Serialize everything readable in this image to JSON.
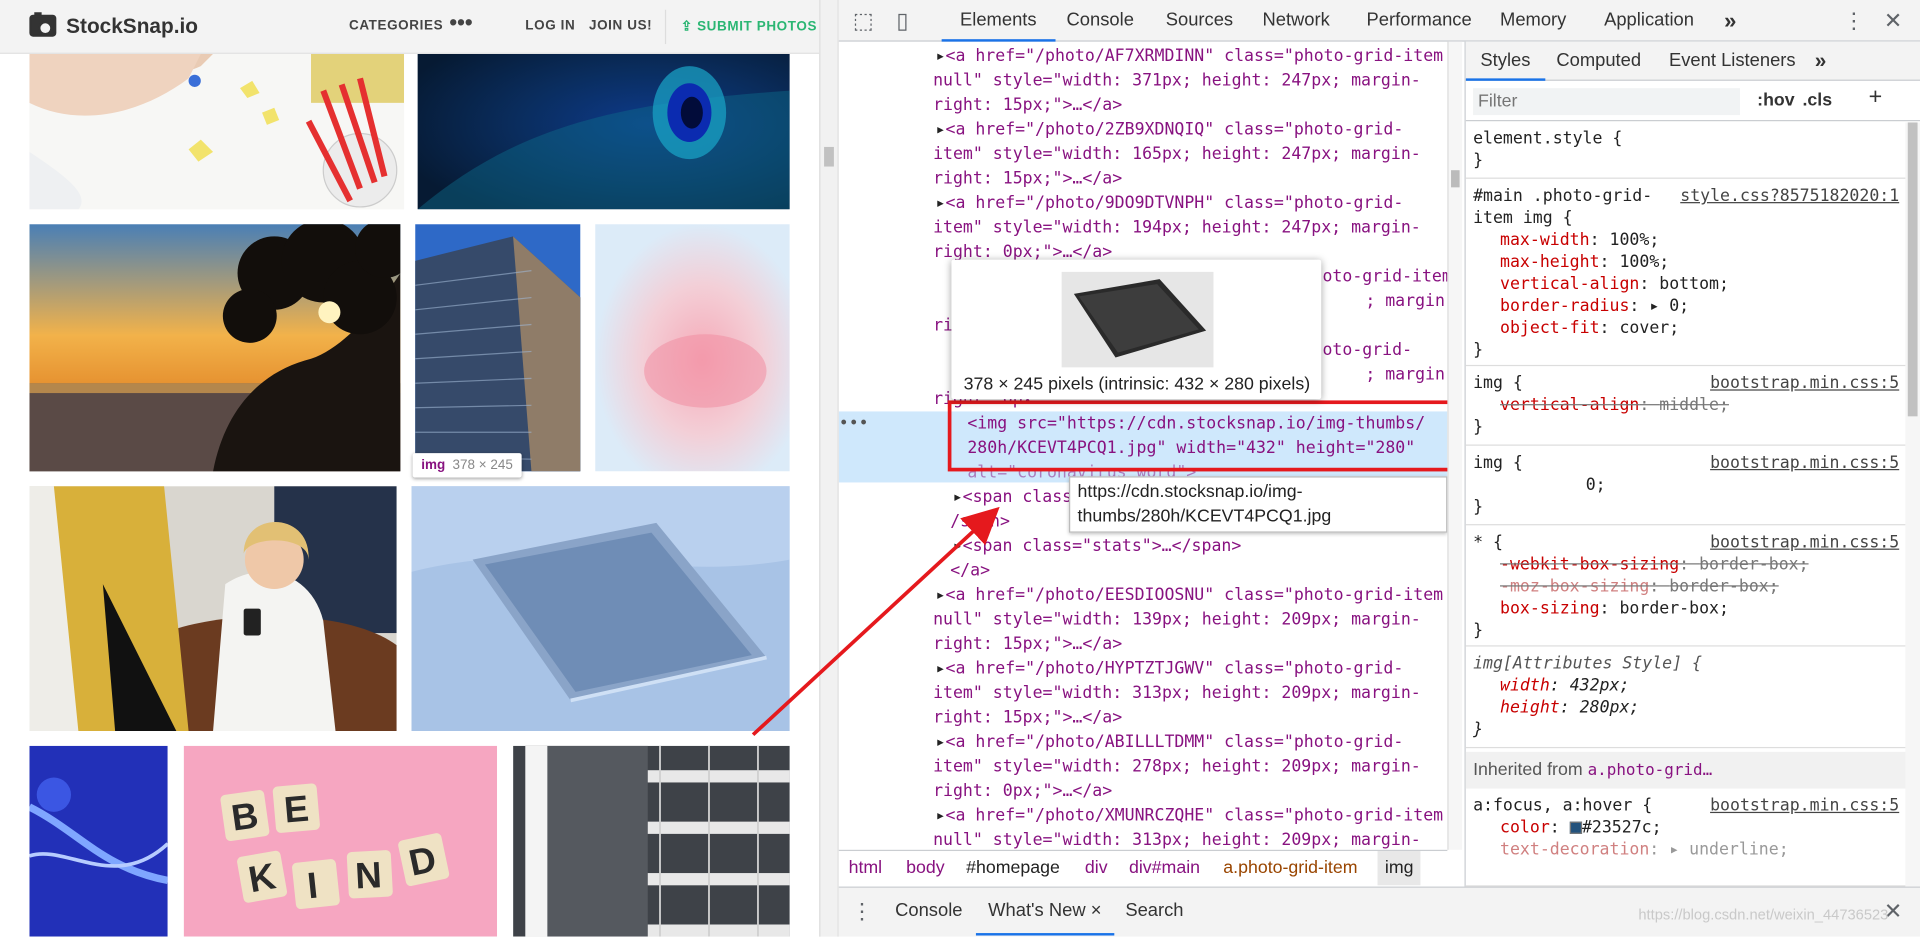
{
  "site": {
    "logo_text": "StockSnap.io",
    "nav": {
      "categories": "CATEGORIES",
      "more": "•••",
      "login": "LOG IN",
      "join": "JOIN US!",
      "submit": "SUBMIT PHOTOS"
    },
    "hover_tag": {
      "tag": "img",
      "size": "378 × 245"
    }
  },
  "devtools": {
    "tabs": [
      "Elements",
      "Console",
      "Sources",
      "Network",
      "Performance",
      "Memory",
      "Application"
    ],
    "more_tabs": "»",
    "dom_lines": [
      "<a href=\"/photo/AF7XRMDINN\" class=\"photo-grid-item",
      "null\" style=\"width: 371px; height: 247px; margin-",
      "right: 15px;\">…</a>",
      "<a href=\"/photo/2ZB9XDNQIQ\" class=\"photo-grid-",
      "item\" style=\"width: 165px; height: 247px; margin-",
      "right: 15px;\">…</a>",
      "<a href=\"/photo/9DO9DTVNPH\" class=\"photo-grid-",
      "item\" style=\"width: 194px; height: 247px; margin-",
      "right: 0px;\">…</a>"
    ],
    "selected_lines": [
      "<img src=\"https://cdn.stocksnap.io/img-thumbs/",
      "280h/KCEVT4PCQ1.jpg\" width=\"432\" height=\"280\""
    ],
    "after_lines": [
      "<span class",
      "/span>",
      "<span class=\"stats\">…</span>",
      "</a>",
      "<a href=\"/photo/EESDIOOSNU\" class=\"photo-grid-item",
      "null\" style=\"width: 139px; height: 209px; margin-",
      "right: 15px;\">…</a>",
      "<a href=\"/photo/HYPTZTJGWV\" class=\"photo-grid-",
      "item\" style=\"width: 313px; height: 209px; margin-",
      "right: 15px;\">…</a>",
      "<a href=\"/photo/ABILLLTDMM\" class=\"photo-grid-",
      "item\" style=\"width: 278px; height: 209px; margin-",
      "right: 0px;\">…</a>",
      "<a href=\"/photo/XMUNRCZQHE\" class=\"photo-grid-item",
      "null\" style=\"width: 313px; height: 209px; margin-"
    ],
    "partial_lines": {
      "l1": "oto-grid-item",
      "l2": "; margin-",
      "l3": "ri",
      "l4": "oto-grid-",
      "l5": "; margin-",
      "l6": "right: 0px",
      "l7": "alt=\"coronavirus word\">",
      "l8": "0;"
    },
    "row_dots": "•••",
    "preview_caption": "378 × 245 pixels (intrinsic: 432 × 280 pixels)",
    "url_tooltip": "https://cdn.stocksnap.io/img-thumbs/280h/KCEVT4PCQ1.jpg",
    "breadcrumbs": [
      "html",
      "body",
      "#homepage",
      "div",
      "div#main",
      "a.photo-grid-item",
      "img"
    ],
    "styles_tabs": [
      "Styles",
      "Computed",
      "Event Listeners"
    ],
    "filter_placeholder": "Filter",
    "hov": ":hov",
    "cls": ".cls",
    "plus": "+",
    "rules": {
      "element_style": "element.style {",
      "close": "}",
      "r1_selector": "#main .photo-grid-item img {",
      "r1_src": "style.css?8575182020:1",
      "r1_props": [
        [
          "max-width",
          "100%;"
        ],
        [
          "max-height",
          "100%;"
        ],
        [
          "vertical-align",
          "bottom;"
        ],
        [
          "border-radius",
          "▸ 0;"
        ],
        [
          "object-fit",
          "cover;"
        ]
      ],
      "r2_selector": "img {",
      "r2_src": "bootstrap.min.css:5",
      "r2_prop": [
        "vertical-align",
        "middle;"
      ],
      "r3_selector": "img {",
      "r3_src": "bootstrap.min.css:5",
      "r4_selector": "* {",
      "r4_src": "bootstrap.min.css:5",
      "r4_props": [
        [
          "-webkit-box-sizing",
          "border-box;"
        ],
        [
          "-moz-box-sizing",
          "border-box;"
        ],
        [
          "box-sizing",
          "border-box;"
        ]
      ],
      "r5_selector": "img[Attributes Style] {",
      "r5_props": [
        [
          "width",
          "432px;"
        ],
        [
          "height",
          "280px;"
        ]
      ],
      "inherited_label": "Inherited from",
      "inherited_from": "a.photo-grid…",
      "r6_selector": "a:focus, a:hover {",
      "r6_src": "bootstrap.min.css:5",
      "r6_props": [
        [
          "color",
          "#23527c;"
        ],
        [
          "text-decoration",
          "▸ underline;"
        ]
      ]
    },
    "drawer_tabs": [
      "Console",
      "What's New",
      "Search"
    ],
    "drawer_close": "×"
  },
  "watermark": "https://blog.csdn.net/weixin_44736523",
  "colors": {
    "accent": "#1a73e8",
    "tag": "#881280",
    "attr": "#994500",
    "highlight": "#e5191d",
    "submit_green": "#2bb673"
  }
}
